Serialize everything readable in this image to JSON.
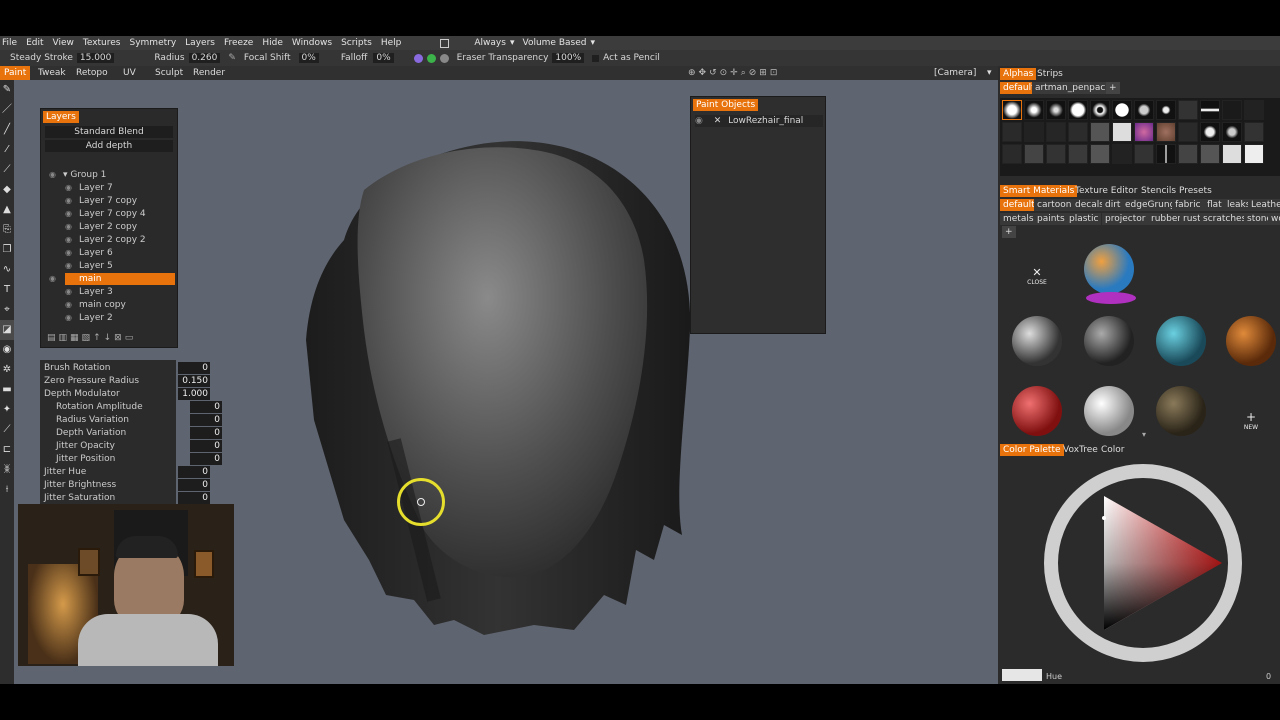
{
  "menu": [
    "File",
    "Edit",
    "View",
    "Textures",
    "Symmetry",
    "Layers",
    "Freeze",
    "Hide",
    "Windows",
    "Scripts",
    "Help"
  ],
  "menu_right": {
    "always": "Always",
    "volume": "Volume Based"
  },
  "options": {
    "steady_label": "Steady Stroke",
    "steady_value": "15.000",
    "radius_label": "Radius",
    "radius_value": "0.260",
    "focal_label": "Focal Shift",
    "focal_value": "0%",
    "falloff_label": "Falloff",
    "falloff_value": "0%",
    "eraser_label": "Eraser Transparency",
    "eraser_value": "100%",
    "act_label": "Act as Pencil"
  },
  "tabs": [
    "Paint",
    "Tweak",
    "Retopo",
    "UV",
    "Sculpt",
    "Render"
  ],
  "camera_label": "[Camera]",
  "layers_panel": {
    "title": "Layers",
    "blend": "Standard Blend",
    "depth": "Add depth",
    "group": "Group 1",
    "items": [
      "Layer 7",
      "Layer 7 copy",
      "Layer 7 copy 4",
      "Layer 2 copy",
      "Layer 2 copy 2",
      "Layer 6",
      "Layer 5",
      "main",
      "Layer 3",
      "main copy",
      "Layer 2"
    ],
    "selected": "main"
  },
  "props": [
    {
      "label": "Brush Rotation",
      "value": "0"
    },
    {
      "label": "Zero Pressure Radius",
      "value": "0.150"
    },
    {
      "label": "Depth Modulator",
      "value": "1.000"
    },
    {
      "label": "Rotation Amplitude",
      "value": "0"
    },
    {
      "label": "Radius Variation",
      "value": "0"
    },
    {
      "label": "Depth Variation",
      "value": "0"
    },
    {
      "label": "Jitter Opacity",
      "value": "0"
    },
    {
      "label": "Jitter Position",
      "value": "0"
    },
    {
      "label": "Jitter Hue",
      "value": "0"
    },
    {
      "label": "Jitter Brightness",
      "value": "0"
    },
    {
      "label": "Jitter Saturation",
      "value": "0"
    }
  ],
  "paint_objects": {
    "title": "Paint Objects",
    "item": "LowRezhair_final"
  },
  "right": {
    "alpha_tabs": [
      "Alphas",
      "Strips"
    ],
    "alpha_sets": [
      "default",
      "artman_penpack"
    ],
    "smart_tabs": [
      "Smart Materials",
      "Texture Editor",
      "Stencils",
      "Presets"
    ],
    "mat_cats_1": [
      "default",
      "cartoon",
      "decals",
      "dirt",
      "edgeGrunge",
      "fabric",
      "flat",
      "leaks",
      "Leathe"
    ],
    "mat_cats_2": [
      "metals",
      "paints",
      "plastic",
      "projector",
      "rubber",
      "rust",
      "scratches",
      "stone",
      "woo"
    ],
    "close_label": "CLOSE",
    "new_label": "NEW",
    "color_tabs": [
      "Color Palette",
      "VoxTree",
      "Color"
    ],
    "hue_label": "Hue",
    "hue_value": "0"
  },
  "colors": {
    "accent": "#e8730c",
    "viewport": "#5e6470"
  }
}
